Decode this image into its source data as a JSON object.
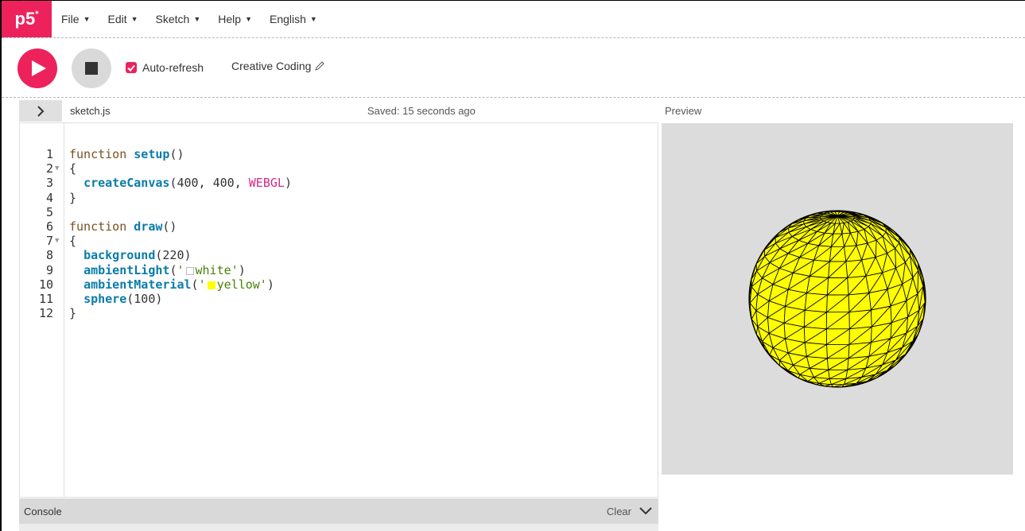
{
  "nav": {
    "logo": "p5",
    "logo_sup": "*",
    "menu": [
      {
        "label": "File"
      },
      {
        "label": "Edit"
      },
      {
        "label": "Sketch"
      },
      {
        "label": "Help"
      },
      {
        "label": "English"
      }
    ]
  },
  "toolbar": {
    "auto_refresh_label": "Auto-refresh",
    "auto_refresh_checked": true,
    "sketch_name": "Creative Coding"
  },
  "editor": {
    "file_name": "sketch.js",
    "saved_status": "Saved: 15 seconds ago",
    "lines": [
      "function setup()",
      "{",
      "  createCanvas(400, 400, WEBGL)",
      "}",
      "",
      "function draw()",
      "{",
      "  background(220)",
      "  ambientLight('white')",
      "  ambientMaterial('yellow')",
      "  sphere(100)",
      "}"
    ]
  },
  "preview": {
    "label": "Preview",
    "background": "#dcdcdc",
    "sphere_color": "#ffff00"
  },
  "console": {
    "title": "Console",
    "clear_label": "Clear"
  },
  "colors": {
    "accent": "#ed225d"
  }
}
